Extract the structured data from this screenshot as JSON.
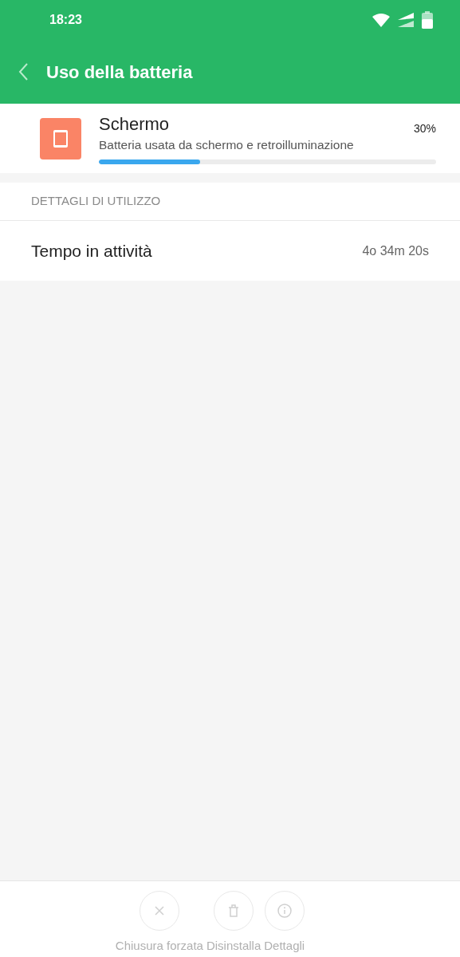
{
  "status_bar": {
    "time": "18:23"
  },
  "app_bar": {
    "title": "Uso della batteria"
  },
  "usage_item": {
    "name": "Schermo",
    "description": "Batteria usata da schermo e retroilluminazione",
    "percent": "30%",
    "level": 0.3
  },
  "section": {
    "header": "DETTAGLI DI UTILIZZO",
    "rows": [
      {
        "label": "Tempo in attività",
        "value": "4o 34m 20s"
      }
    ]
  },
  "actions": [
    {
      "kind": "close",
      "label": "Chiusura forzata",
      "disabled": true
    },
    {
      "kind": "trash",
      "label": "Disinstalla",
      "disabled": true
    },
    {
      "kind": "info",
      "label": "Dettagli",
      "disabled": true
    }
  ]
}
